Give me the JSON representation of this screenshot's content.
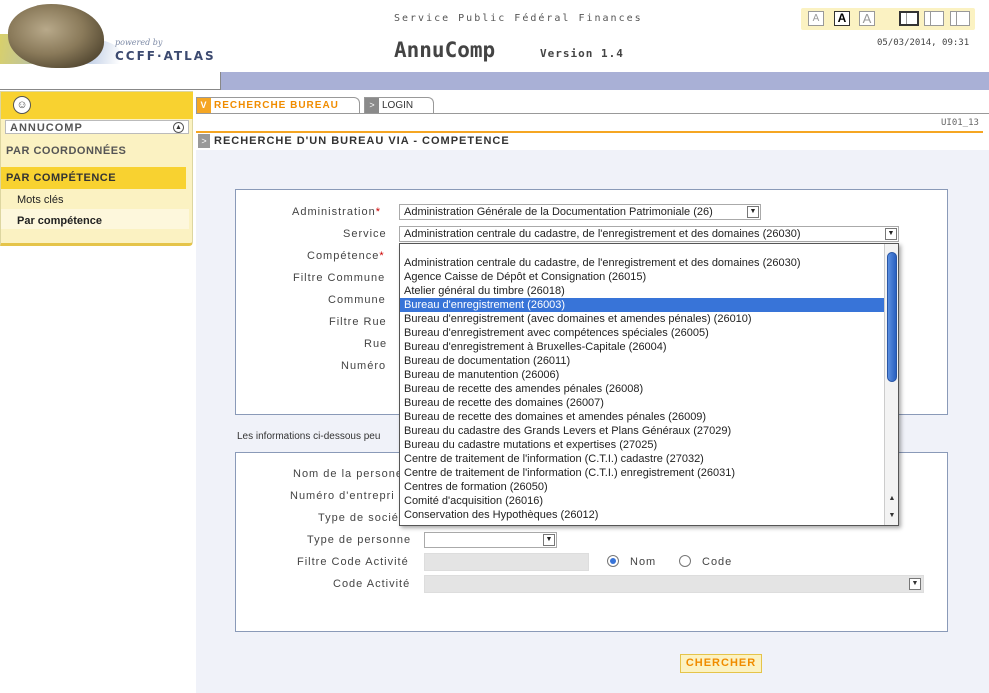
{
  "header": {
    "powered_by": "powered by",
    "org": "CCFF·ATLAS",
    "service": "Service Public Fédéral Finances",
    "app_name": "AnnuComp",
    "version": "Version 1.4",
    "datetime": "05/03/2014, 09:31",
    "font_buttons": [
      "A",
      "A",
      "A"
    ]
  },
  "sidebar": {
    "section_title": "ANNUCOMP",
    "items": [
      {
        "label": "PAR COORDONNÉES"
      },
      {
        "label": "PAR COMPÉTENCE"
      }
    ],
    "subitems": [
      {
        "label": "Mots clés"
      },
      {
        "label": "Par compétence"
      }
    ]
  },
  "tabs": [
    {
      "label": "RECHERCHE BUREAU"
    },
    {
      "label": "LOGIN"
    }
  ],
  "page": {
    "code": "UI01_13",
    "title": "RECHERCHE D'UN BUREAU VIA - COMPETENCE"
  },
  "form1": {
    "administration_label": "Administration",
    "administration_value": "Administration Générale de la Documentation Patrimoniale (26)",
    "service_label": "Service",
    "service_value": "Administration centrale du cadastre, de l'enregistrement et des domaines (26030)",
    "competence_label": "Compétence",
    "filtre_commune_label": "Filtre Commune",
    "commune_label": "Commune",
    "filtre_rue_label": "Filtre Rue",
    "rue_label": "Rue",
    "numero_label": "Numéro",
    "required_mark": "*"
  },
  "service_dropdown": {
    "options": [
      "Administration centrale du cadastre, de l'enregistrement et des domaines (26030)",
      "Agence Caisse de Dépôt et Consignation (26015)",
      "Atelier général du timbre (26018)",
      "Bureau d'enregistrement (26003)",
      "Bureau d'enregistrement (avec domaines et amendes pénales) (26010)",
      "Bureau d'enregistrement avec compétences spéciales (26005)",
      "Bureau d'enregistrement à Bruxelles-Capitale (26004)",
      "Bureau de documentation (26011)",
      "Bureau de manutention (26006)",
      "Bureau de recette des amendes pénales (26008)",
      "Bureau de recette des domaines (26007)",
      "Bureau de recette des domaines et amendes pénales (26009)",
      "Bureau du cadastre des Grands Levers et Plans Généraux (27029)",
      "Bureau du cadastre mutations et expertises (27025)",
      "Centre de traitement de l'information (C.T.I.) cadastre (27032)",
      "Centre de traitement de l'information (C.T.I.) enregistrement (26031)",
      "Centres de formation (26050)",
      "Comité d'acquisition (26016)",
      "Conservation des Hypothèques (26012)"
    ],
    "selected_index": 3
  },
  "info_text": "Les informations ci-dessous peu",
  "form2": {
    "nom_label": "Nom de la persone",
    "numero_label": "Numéro d'entrepri",
    "type_soc_label": "Type de socié",
    "type_personne_label": "Type de personne",
    "filtre_code_label": "Filtre Code Activité",
    "code_activite_label": "Code Activité",
    "radio_nom": "Nom",
    "radio_code": "Code"
  },
  "search_button": "CHERCHER",
  "colors": {
    "accent": "#f08c00",
    "sidebar_bg": "#fbf2c2",
    "sidebar_active": "#f8d230",
    "topbar": "#a9b0d6",
    "selection": "#3874d8"
  }
}
